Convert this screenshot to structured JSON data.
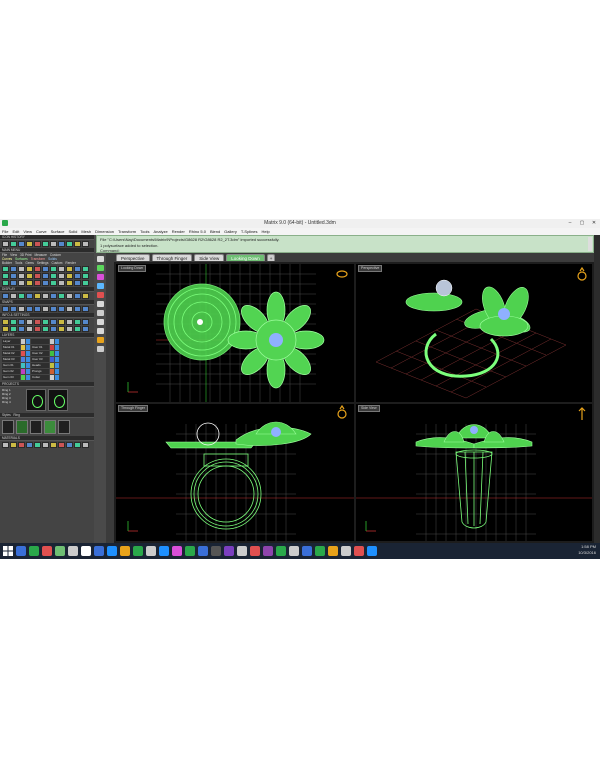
{
  "window": {
    "title": "Matrix 9.0 (64-bit) - Untitled.3dm",
    "controls": [
      "–",
      "▢",
      "✕"
    ],
    "menu": [
      "File",
      "Edit",
      "View",
      "Curve",
      "Surface",
      "Solid",
      "Mesh",
      "Dimension",
      "Transform",
      "Tools",
      "Analyze",
      "Render",
      "Rhino 5.0",
      "Blend",
      "Gallery",
      "T-Splines",
      "Help"
    ]
  },
  "left_panel": {
    "icon_history_header": "ICON HISTORY",
    "main_menu_header": "MAIN MENU",
    "main_menu_row1": [
      "File",
      "View",
      "3D Print",
      "Measure",
      "Custom"
    ],
    "main_menu_row2": [
      "Curves",
      "Surfaces",
      "Transform",
      "Solids"
    ],
    "main_menu_row3": [
      "Builder",
      "Tools",
      "Gems",
      "Settings",
      "Custom",
      "Render"
    ],
    "display_header": "DISPLAY",
    "snaps_header": "SNAPS",
    "info_settings_header": "INFO & SETTINGS",
    "layers_header": "LAYERS",
    "layers": [
      {
        "name": "Layer",
        "color": "#c9c9c9"
      },
      {
        "name": "Metal 01",
        "color": "#e0c040"
      },
      {
        "name": "Metal 02",
        "color": "#e05050"
      },
      {
        "name": "Metal 03",
        "color": "#5080e0"
      },
      {
        "name": "Gem 01",
        "color": "#40c0c0"
      },
      {
        "name": "Gem 02",
        "color": "#c040c0"
      },
      {
        "name": "Gem 03",
        "color": "#50d050"
      }
    ],
    "layers_right": [
      {
        "name": "",
        "color": "#c9c9c9"
      },
      {
        "name": "User 01",
        "color": "#d04040"
      },
      {
        "name": "User 02",
        "color": "#40c040"
      },
      {
        "name": "User 03",
        "color": "#4060d0"
      },
      {
        "name": "Heads",
        "color": "#c0c040"
      },
      {
        "name": "Prongs",
        "color": "#d06030"
      },
      {
        "name": "Cutter",
        "color": "#d0d0d0"
      }
    ],
    "projects_header": "PROJECTS",
    "project_items": [
      "Ring 1",
      "Ring 2",
      "Ring 3",
      "Ring 4"
    ],
    "styles_header": "Styles",
    "styles_tab2": "Ring",
    "materials_header": "MATERIALS"
  },
  "command": {
    "lines": [
      "File \"C:\\Users\\Nay\\Documents\\Matrix9\\Projects\\G8628 R2\\G8628 R2_2T.3dm\" imported successfully.",
      "1 polysurface added to selection.",
      "Command:"
    ]
  },
  "tabs": [
    {
      "label": "Perspective",
      "active": false
    },
    {
      "label": "Through Finger",
      "active": false
    },
    {
      "label": "Side View",
      "active": false
    },
    {
      "label": "Looking Down",
      "active": true
    },
    {
      "label": "+",
      "active": false
    }
  ],
  "viewports": {
    "top_left": "Looking Down",
    "top_right": "Perspective",
    "bottom_left": "Through Finger",
    "bottom_right": "Side View"
  },
  "taskbar": {
    "time": "1:58 PM",
    "date": "10/3/2016"
  },
  "colors": {
    "wire": "#7cff7c",
    "wire_dark": "#3ea23e",
    "gem": "#8fb0ff",
    "grid": "#4a4a4a",
    "axis_red": "#c03030",
    "axis_green": "#30c030",
    "accent_tab": "#6fbf74",
    "ring_icon": "#e7a21b"
  }
}
